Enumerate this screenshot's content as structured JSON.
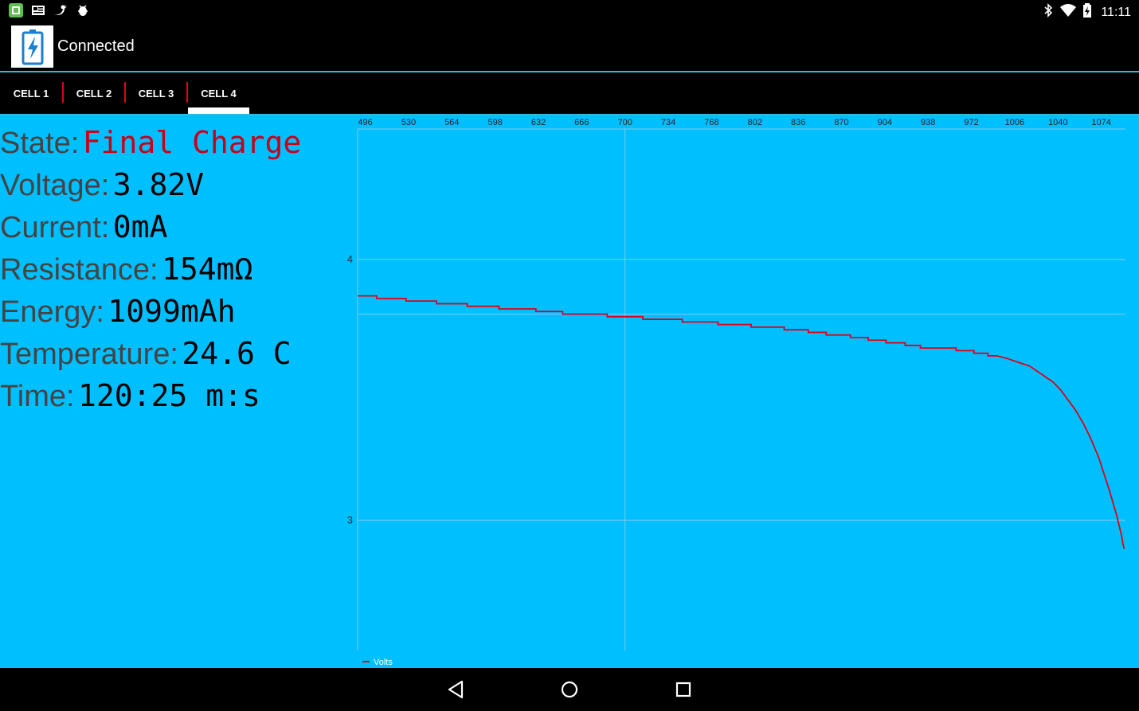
{
  "status_bar": {
    "time": "11:11",
    "left_icons": [
      "notification-app-icon",
      "news-icon",
      "twitter-icon",
      "android-debug-icon"
    ],
    "right_icons": [
      "bluetooth-icon",
      "wifi-icon",
      "battery-charging-icon"
    ]
  },
  "action_bar": {
    "title": "Connected",
    "icon": "battery-charging-icon"
  },
  "tabs": [
    {
      "label": "CELL 1",
      "selected": false
    },
    {
      "label": "CELL 2",
      "selected": false
    },
    {
      "label": "CELL 3",
      "selected": false
    },
    {
      "label": "CELL 4",
      "selected": true
    }
  ],
  "readings": [
    {
      "label": "State:",
      "value": "Final Charge"
    },
    {
      "label": "Voltage:",
      "value": "3.82V"
    },
    {
      "label": "Current:",
      "value": "0mA"
    },
    {
      "label": "Resistance:",
      "value": "154mΩ"
    },
    {
      "label": "Energy:",
      "value": "1099mAh"
    },
    {
      "label": "Temperature:",
      "value": "24.6 C"
    },
    {
      "label": "Time:",
      "value": "120:25 m:s"
    }
  ],
  "colors": {
    "accent": "#33b5e5",
    "content_background": "#00bfff",
    "state_value": "#c8001a",
    "series_line": "#e0001a",
    "tab_divider": "#e0001a"
  },
  "chart_data": {
    "type": "line",
    "title": "",
    "xlabel": "",
    "ylabel": "",
    "x_ticks": [
      496,
      530,
      564,
      598,
      632,
      666,
      700,
      734,
      768,
      802,
      836,
      870,
      904,
      938,
      972,
      1006,
      1040,
      1074
    ],
    "y_ticks": [
      3,
      4
    ],
    "xlim": [
      490,
      1093
    ],
    "ylim": [
      2.5,
      4.5
    ],
    "grid": true,
    "legend_position": "bottom-left",
    "series": [
      {
        "name": "Volts",
        "color": "#e0001a",
        "x": [
          490,
          505,
          505,
          528,
          528,
          552,
          552,
          576,
          576,
          601,
          601,
          630,
          630,
          651,
          651,
          686,
          686,
          714,
          714,
          745,
          745,
          773,
          773,
          799,
          799,
          825,
          825,
          844,
          844,
          858,
          858,
          877,
          877,
          891,
          891,
          905,
          905,
          920,
          920,
          932,
          932,
          960,
          960,
          974,
          974,
          985,
          985,
          992,
          1000,
          1006,
          1012,
          1018,
          1024,
          1030,
          1036,
          1042,
          1048,
          1054,
          1060,
          1066,
          1072,
          1076,
          1080,
          1083,
          1086,
          1088,
          1090,
          1091,
          1092
        ],
        "values": [
          3.86,
          3.86,
          3.85,
          3.85,
          3.84,
          3.84,
          3.83,
          3.83,
          3.82,
          3.82,
          3.81,
          3.81,
          3.8,
          3.8,
          3.79,
          3.79,
          3.78,
          3.78,
          3.77,
          3.77,
          3.76,
          3.76,
          3.75,
          3.75,
          3.74,
          3.74,
          3.73,
          3.73,
          3.72,
          3.72,
          3.71,
          3.71,
          3.7,
          3.7,
          3.69,
          3.69,
          3.68,
          3.68,
          3.67,
          3.67,
          3.66,
          3.66,
          3.65,
          3.65,
          3.64,
          3.64,
          3.63,
          3.63,
          3.62,
          3.61,
          3.6,
          3.59,
          3.57,
          3.55,
          3.53,
          3.5,
          3.46,
          3.42,
          3.37,
          3.31,
          3.24,
          3.18,
          3.12,
          3.07,
          3.02,
          2.98,
          2.94,
          2.91,
          2.89
        ]
      }
    ]
  }
}
